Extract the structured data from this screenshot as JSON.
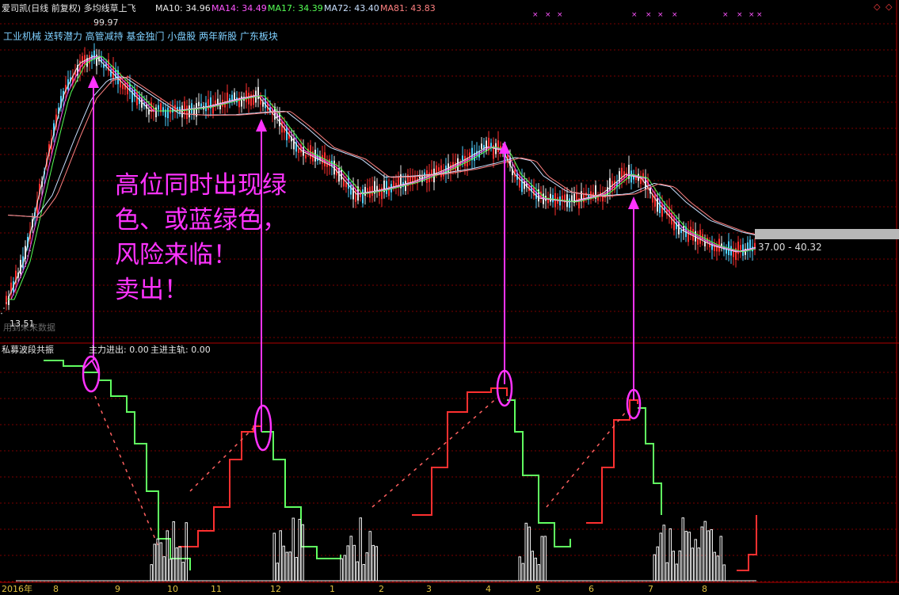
{
  "header": {
    "title": "爱司凯(日线 前复权) 多均线草上飞",
    "ma10": "MA10: 34.96",
    "ma14": "MA14: 34.49",
    "ma17": "MA17: 34.39",
    "ma72": "MA72: 43.40",
    "ma81": "MA81: 43.83",
    "concepts": "工业机械 送转潜力 高管减持 基金独门 小盘股 两年新股 广东板块"
  },
  "price_panel": {
    "peak_label": "99.97",
    "low_label": "13.51",
    "faint_label": "用到未来数据",
    "range_label": "37.00 - 40.32"
  },
  "annotation": {
    "line1": "高位同时出现绿",
    "line2": "色、或蓝绿色，",
    "line3": "风险来临！",
    "line4": "卖出！",
    "color": "#ff33ff"
  },
  "indicator_panel": {
    "title": "私募波段共振",
    "main_flow": "主力进出: 0.00",
    "main_rail": "主进主轨: 0.00"
  },
  "x_axis": {
    "labels": [
      "2016年",
      "8",
      "9",
      "10",
      "11",
      "12",
      "1",
      "2",
      "3",
      "4",
      "5",
      "6",
      "7",
      "8"
    ]
  },
  "colors": {
    "up": "#ff3030",
    "down": "#60ff60",
    "grid": "#7a0000",
    "accent": "#ff33ff"
  }
}
